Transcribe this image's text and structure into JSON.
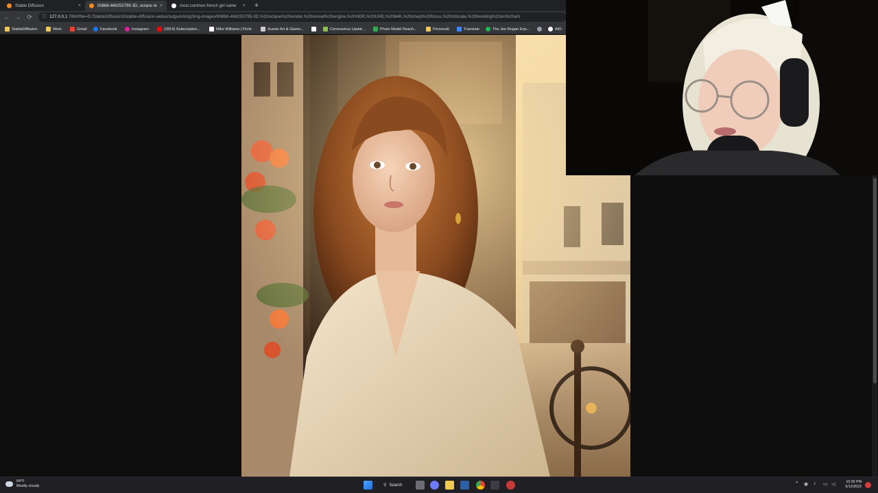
{
  "browser": {
    "tabs": [
      {
        "label": "Stable Diffusion",
        "favicon_color": "#f28b24"
      },
      {
        "label": "00868-466253799-3D, octane re",
        "favicon_color": "#f28b24"
      },
      {
        "label": "most common french girl name",
        "favicon_color": "#ffffff"
      }
    ],
    "close_glyph": "×",
    "new_tab_glyph": "+",
    "address": {
      "host": "127.0.0.1",
      "path": ":7860/file=D:/StableDiffusion2/stable-diffusion-webui/outputs/img2img-images/00868-466253799-3D,%20octane%20render,%20unreal%20engine,%20HDR,%20UHD,%2064K,%20sharp%20focus,%20intricate,%20trending%20on%20arti"
    },
    "bookmarks": [
      {
        "label": "StableDiffusion",
        "icon": "folder-icon",
        "color": "#f2c94c"
      },
      {
        "label": "Work",
        "icon": "folder-icon",
        "color": "#f2c94c"
      },
      {
        "label": "Gmail",
        "icon": "gmail-icon",
        "color": "#ea4335"
      },
      {
        "label": "Facebook",
        "icon": "facebook-icon",
        "color": "#1877f2"
      },
      {
        "label": "Instagram",
        "icon": "instagram-icon",
        "color": "#d6249f"
      },
      {
        "label": "(2814) Subscription...",
        "icon": "youtube-icon",
        "color": "#ff0000"
      },
      {
        "label": "Mike Williams | Flickr",
        "icon": "flickr-icon",
        "color": "#ffffff"
      },
      {
        "label": "Aussie Art & Glamo...",
        "icon": "page-icon",
        "color": "#cccccc"
      },
      {
        "label": "",
        "icon": "box-icon",
        "color": "#ffffff"
      },
      {
        "label": "Coronavirus Updat...",
        "icon": "page-icon",
        "color": "#8bc34a"
      },
      {
        "label": "Photo Model Reach...",
        "icon": "page-icon",
        "color": "#34a853"
      },
      {
        "label": "Persona5",
        "icon": "folder-icon",
        "color": "#f2c94c"
      },
      {
        "label": "Translate",
        "icon": "translate-icon",
        "color": "#4285f4"
      },
      {
        "label": "The Joe Rogan Exp...",
        "icon": "spotify-icon",
        "color": "#1db954"
      },
      {
        "label": "",
        "icon": "globe-icon",
        "color": "#9aa0a6"
      },
      {
        "label": "AID-",
        "icon": "github-icon",
        "color": "#ffffff"
      }
    ]
  },
  "taskbar": {
    "weather_temp": "64°F",
    "weather_desc": "Mostly cloudy",
    "search_label": "Search",
    "time": "10:35 PM",
    "date": "5/12/2023"
  }
}
